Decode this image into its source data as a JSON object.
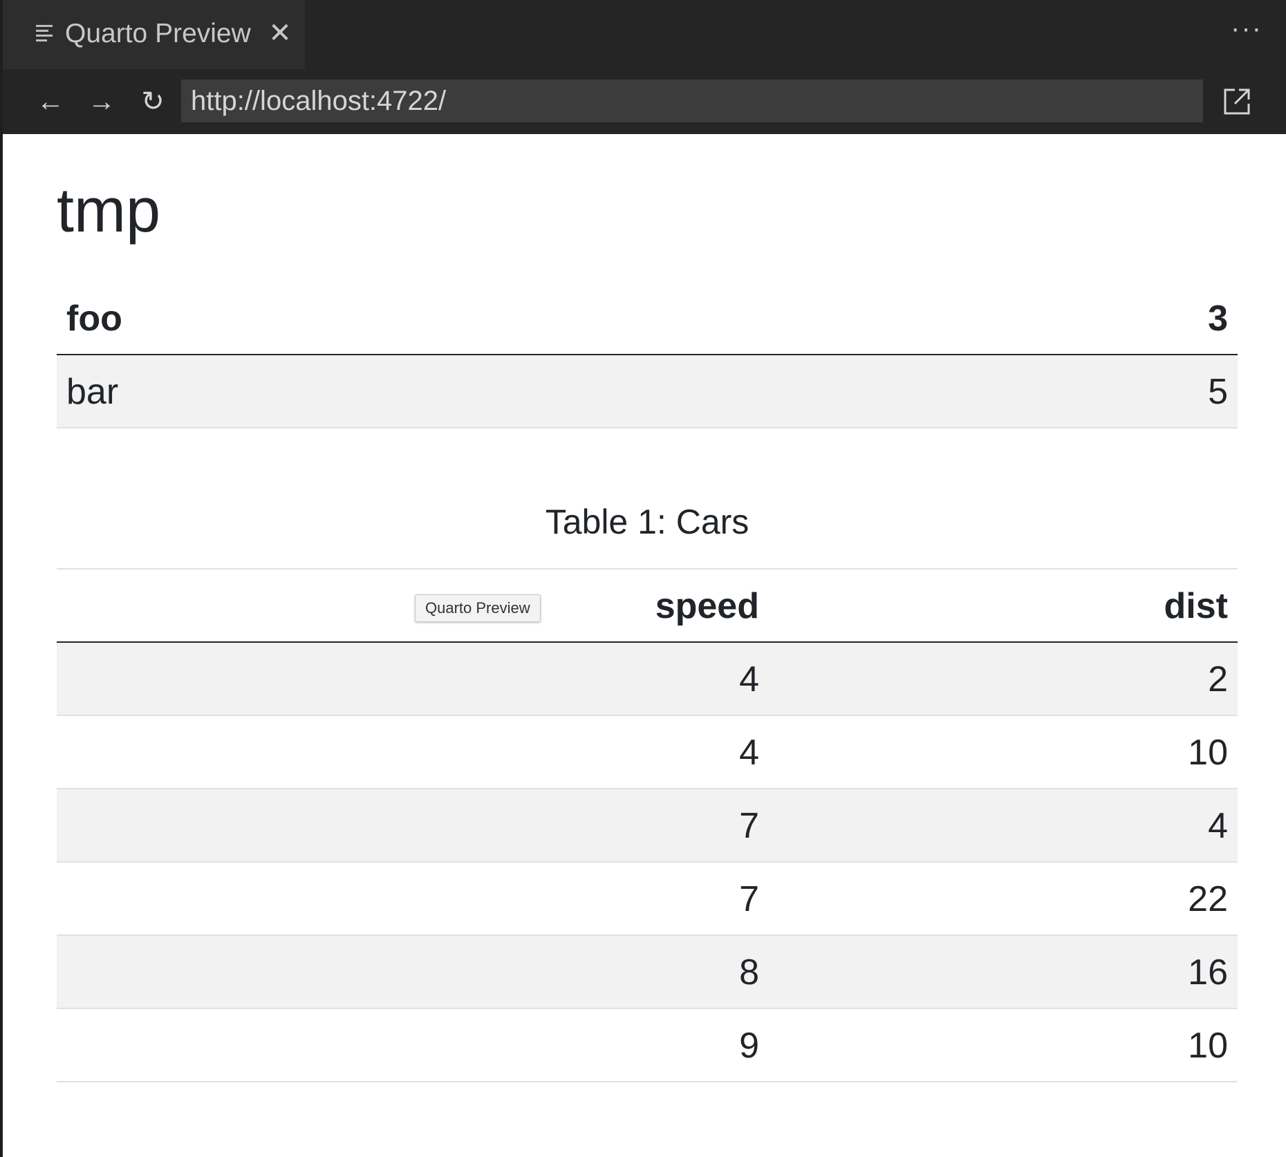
{
  "tab": {
    "label": "Quarto Preview",
    "list_icon": "list-icon",
    "close_icon": "close-icon",
    "more_icon": "more-icon"
  },
  "nav": {
    "back_icon": "back-arrow-icon",
    "forward_icon": "forward-arrow-icon",
    "reload_icon": "reload-icon",
    "url": "http://localhost:4722/",
    "open_external_icon": "open-external-icon"
  },
  "page": {
    "title": "tmp"
  },
  "table1": {
    "header": [
      "foo",
      "3"
    ],
    "rows": [
      [
        "bar",
        "5"
      ]
    ]
  },
  "table2": {
    "caption": "Table 1: Cars",
    "columns": [
      "speed",
      "dist"
    ],
    "rows": [
      [
        "4",
        "2"
      ],
      [
        "4",
        "10"
      ],
      [
        "7",
        "4"
      ],
      [
        "7",
        "22"
      ],
      [
        "8",
        "16"
      ],
      [
        "9",
        "10"
      ]
    ]
  },
  "tooltip": {
    "text": "Quarto Preview"
  }
}
